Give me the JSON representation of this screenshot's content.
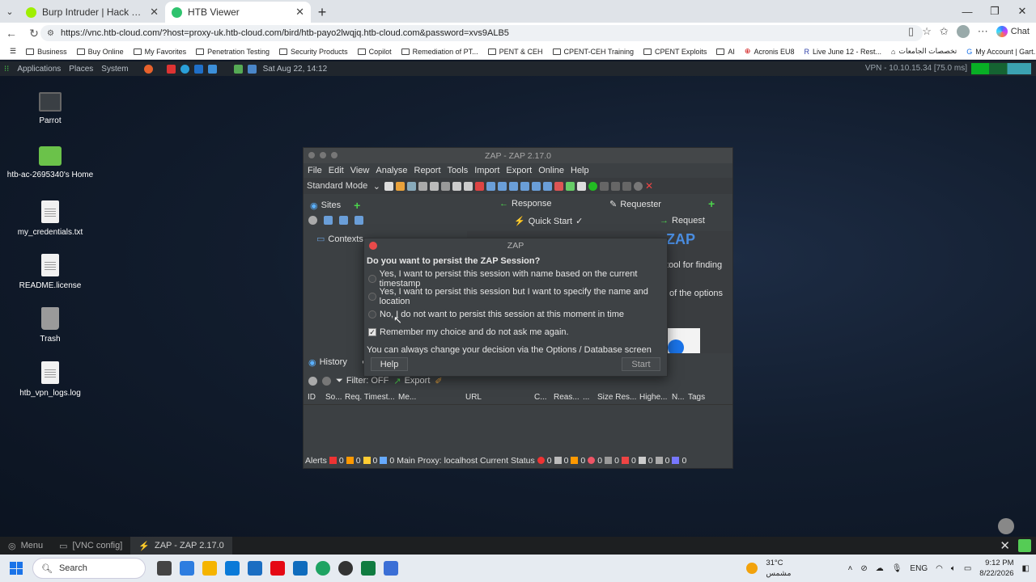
{
  "browser": {
    "tabs": [
      {
        "title": "Burp Intruder | Hack The Box Acad"
      },
      {
        "title": "HTB Viewer"
      }
    ],
    "url": "https://vnc.htb-cloud.com/?host=proxy-uk.htb-cloud.com/bird/htb-payo2lwqjq.htb-cloud.com&password=xvs9ALB5",
    "chat_label": "Chat",
    "bookmarks": [
      "Business",
      "Buy Online",
      "My Favorites",
      "Penetration Testing",
      "Security Products",
      "Copilot",
      "Remediation of PT...",
      "PENT & CEH",
      "CPENT-CEH Training",
      "CPENT Exploits",
      "AI",
      "Acronis EU8",
      "Live June 12 - Rest...",
      "تخصصات الجامعات",
      "My Account | Gart..."
    ]
  },
  "parrot_panel": {
    "menus": [
      "Applications",
      "Places",
      "System"
    ],
    "datetime": "Sat Aug 22, 14:12",
    "vpn": "VPN - 10.10.15.34 [75.0 ms]"
  },
  "desktop_icons": [
    {
      "label": "Parrot"
    },
    {
      "label": "htb-ac-2695340's Home"
    },
    {
      "label": "my_credentials.txt"
    },
    {
      "label": "README.license"
    },
    {
      "label": "Trash"
    },
    {
      "label": "htb_vpn_logs.log"
    }
  ],
  "zap": {
    "title": "ZAP - ZAP 2.17.0",
    "menu": [
      "File",
      "Edit",
      "View",
      "Analyse",
      "Report",
      "Tools",
      "Import",
      "Export",
      "Online",
      "Help"
    ],
    "mode": "Standard Mode",
    "left_tabs": {
      "sites": "Sites",
      "contexts": "Contexts"
    },
    "right_tabs": {
      "response": "Response",
      "requester": "Requester",
      "quick_start": "Quick Start",
      "request": "Request"
    },
    "bg_text": [
      "tool for finding",
      "of the options"
    ],
    "history": {
      "tab": "History",
      "filter": "Filter: OFF",
      "export": "Export",
      "columns": [
        "ID",
        "So...",
        "Req. Timest...",
        "Me...",
        "URL",
        "C...",
        "Reas...",
        "...",
        "Size Res...",
        "Highe...",
        "N...",
        "Tags"
      ]
    },
    "status": {
      "alerts_label": "Alerts",
      "alert_counts": [
        "0",
        "0",
        "0",
        "0"
      ],
      "proxy": "Main Proxy: localhost",
      "current_status": "Current Status",
      "status_counts": [
        "0",
        "0",
        "0",
        "0",
        "0",
        "0",
        "0",
        "0",
        "0"
      ]
    }
  },
  "dialog": {
    "title": "ZAP",
    "question": "Do you want to persist the ZAP Session?",
    "options": [
      "Yes, I want to persist this session with name based on the current timestamp",
      "Yes, I want to persist this session but I want to specify the name and location",
      "No, I do not want to persist this session at this moment in time"
    ],
    "remember": "Remember my choice and do not ask me again.",
    "note": "You can always change your decision via the Options / Database screen",
    "help_btn": "Help",
    "start_btn": "Start"
  },
  "vnc_panel": {
    "menu": "Menu",
    "items": [
      "[VNC config]",
      "ZAP - ZAP 2.17.0"
    ]
  },
  "taskbar": {
    "search": "Search",
    "weather_temp": "31°C",
    "weather_desc": "مشمس",
    "lang": "ENG",
    "time": "9:12 PM",
    "date": "8/22/2026"
  },
  "colors": {
    "accent": "#1a73e8",
    "zap_bg": "#3c4043",
    "close_red": "#e94a4a",
    "add_green": "#4cd34c"
  }
}
